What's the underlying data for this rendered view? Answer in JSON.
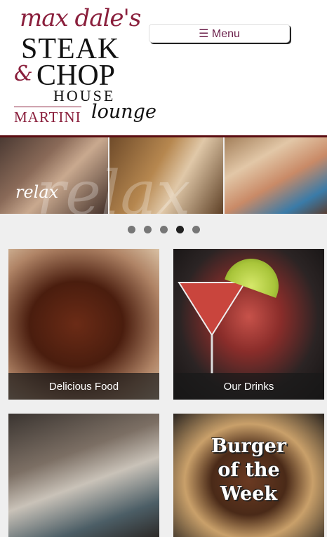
{
  "logo": {
    "line1": "max dale's",
    "line2": "STEAK",
    "amp": "&",
    "line3": "CHOP",
    "line4": "HOUSE",
    "line5": "MARTINI",
    "line6": "lounge"
  },
  "nav": {
    "menu_label": "☰ Menu"
  },
  "banner": {
    "caption": "relax",
    "ghost": "relax"
  },
  "carousel": {
    "count": 5,
    "active_index": 3
  },
  "tiles": [
    {
      "caption": "Delicious Food"
    },
    {
      "caption": "Our Drinks"
    },
    {
      "caption": ""
    },
    {
      "caption": "Burger\nof the\nWeek"
    }
  ]
}
